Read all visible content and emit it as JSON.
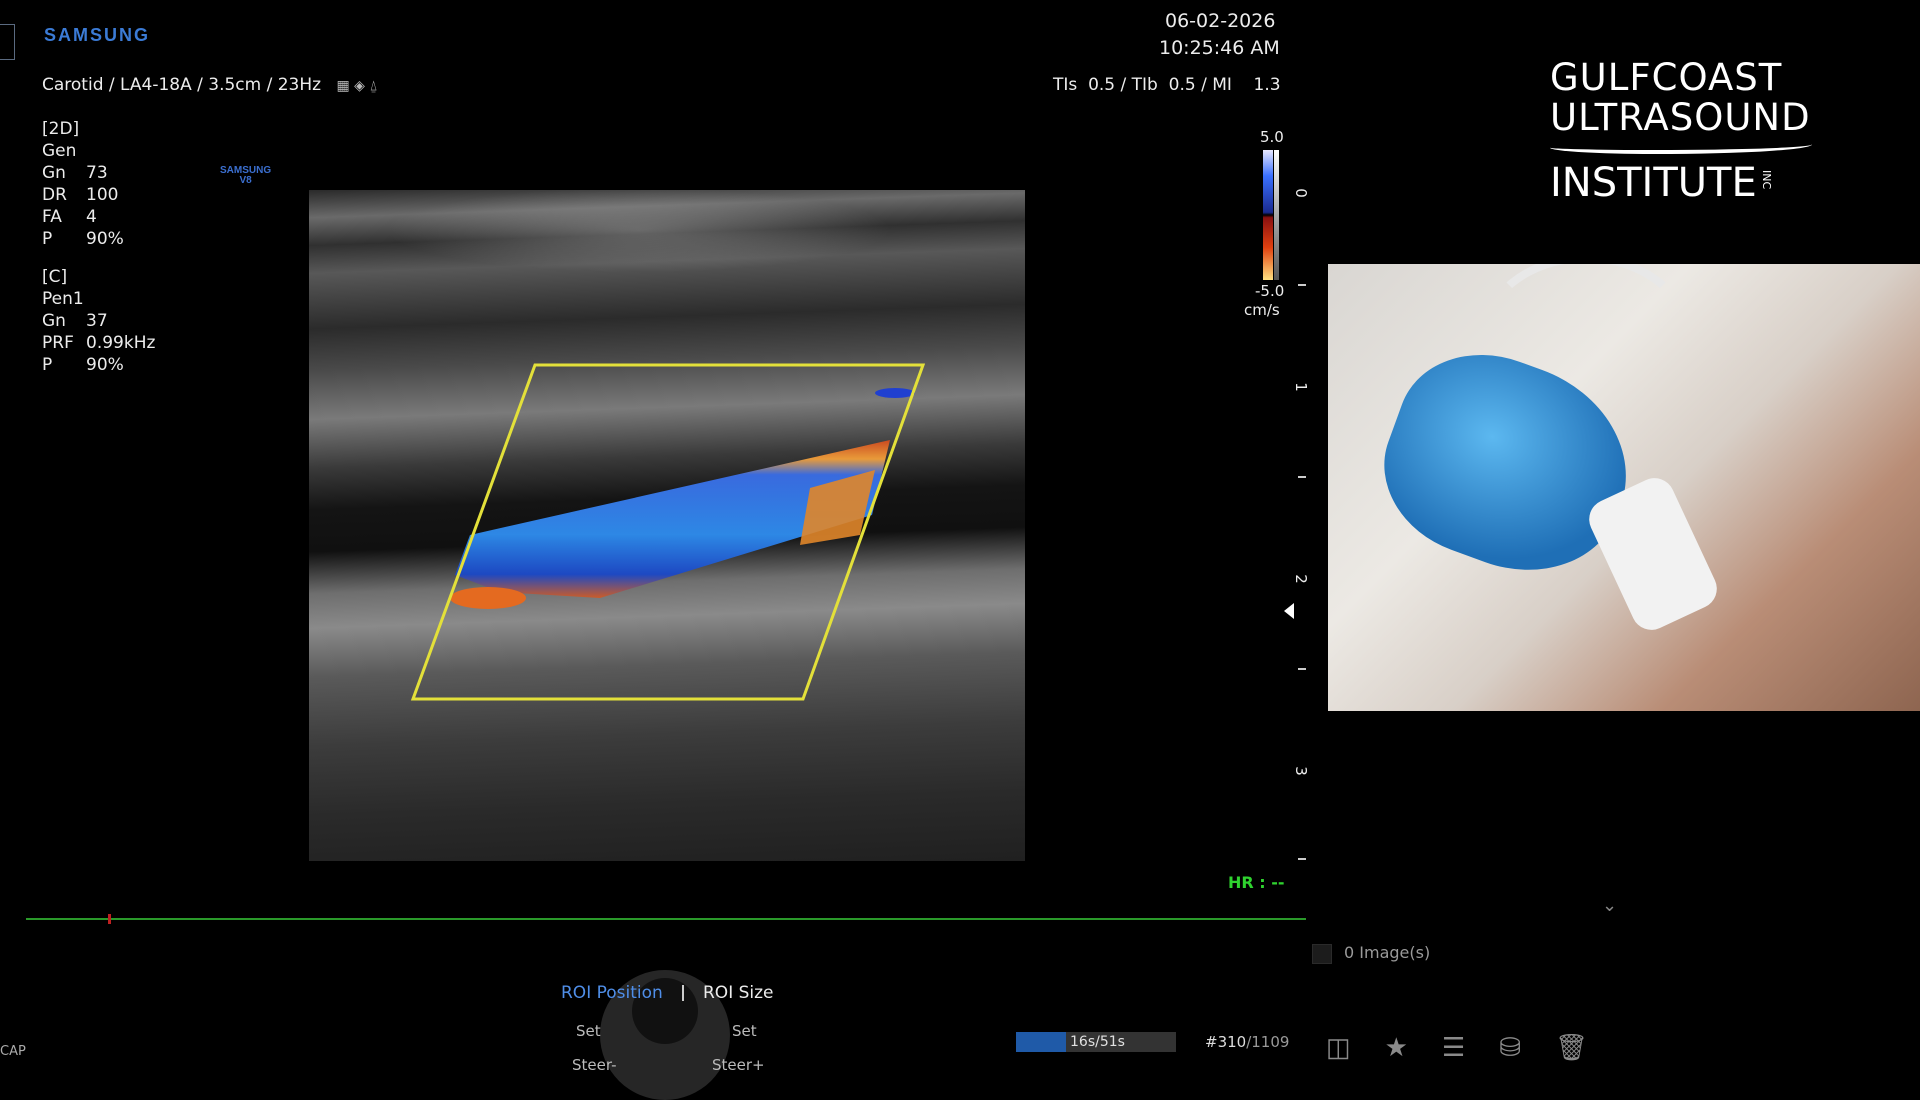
{
  "header": {
    "brand": "SAMSUNG",
    "date": "06-02-2026",
    "time": "10:25:46 AM",
    "preset": "Carotid / LA4-18A / 3.5cm / 23Hz",
    "indices": "TIs  0.5 / TIb  0.5 / MI    1.3"
  },
  "params_2d": {
    "title": "[2D]",
    "mode": "Gen",
    "rows": [
      {
        "k": "Gn",
        "v": "73"
      },
      {
        "k": "DR",
        "v": "100"
      },
      {
        "k": "FA",
        "v": "4"
      },
      {
        "k": "P",
        "v": "90%"
      }
    ]
  },
  "params_c": {
    "title": "[C]",
    "mode": "Pen1",
    "rows": [
      {
        "k": "Gn",
        "v": "37"
      },
      {
        "k": "PRF",
        "v": "0.99kHz"
      },
      {
        "k": "P",
        "v": "90%"
      }
    ]
  },
  "small_logo": {
    "line1": "SAMSUNG",
    "line2": "V8"
  },
  "color_scale": {
    "top": "5.0",
    "bottom": "-5.0",
    "unit": "cm/s"
  },
  "depth_scale": {
    "labels": [
      "0",
      "1",
      "2",
      "3"
    ]
  },
  "hr": "HR : --",
  "institute": {
    "line1": "GULFCOAST",
    "line2": "ULTRASOUND",
    "line3": "INSTITUTE",
    "suffix": "INC"
  },
  "images": "0 Image(s)",
  "roi": {
    "position": "ROI Position",
    "size": "ROI Size",
    "set_left": "Set",
    "set_right": "Set",
    "steer_left": "Steer-",
    "steer_right": "Steer+"
  },
  "cine": {
    "time": "16s/51s",
    "progress": 0.31,
    "frame_current": "#310",
    "frame_total": "/1109"
  },
  "corner": "CAP",
  "colors": {
    "accent": "#3b7bd6",
    "roi_box": "#e3e03a",
    "hr": "#2fd22f",
    "timeline": "#2a9a2a"
  }
}
